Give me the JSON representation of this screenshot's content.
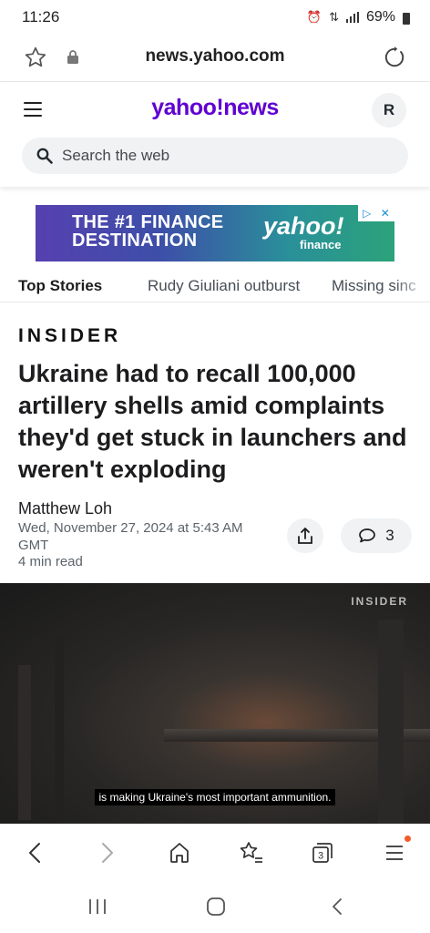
{
  "status": {
    "time": "11:26",
    "battery": "69%"
  },
  "browser": {
    "url": "news.yahoo.com",
    "tab_count": "3"
  },
  "header": {
    "logo_yahoo": "yahoo",
    "logo_bang": "!",
    "logo_news": "news",
    "avatar_initial": "R"
  },
  "search": {
    "placeholder": "Search the web"
  },
  "ad": {
    "headline": "THE #1 FINANCE DESTINATION",
    "logo": "yahoo!",
    "logo_sub": "finance"
  },
  "tabs": [
    {
      "label": "Top Stories"
    },
    {
      "label": "Rudy Giuliani outburst"
    },
    {
      "label": "Missing sinc"
    }
  ],
  "article": {
    "source": "INSIDER",
    "headline": "Ukraine had to recall 100,000 artillery shells amid complaints they'd get stuck in launchers and weren't exploding",
    "author": "Matthew Loh",
    "date": "Wed, November 27, 2024 at 5:43 AM GMT",
    "read_time": "4 min read",
    "comment_count": "3"
  },
  "video": {
    "brand": "INSIDER",
    "caption": "is making Ukraine's most important ammunition."
  },
  "icons": {
    "bookmark": "star-icon",
    "lock": "lock-icon",
    "reload": "reload-icon",
    "menu": "hamburger-icon",
    "search": "search-icon",
    "share": "share-icon",
    "comment": "comment-icon",
    "back": "back-icon",
    "forward": "forward-icon",
    "home": "home-icon",
    "bookmarks": "bookmarks-icon",
    "tabs": "tabs-icon",
    "more": "menu-icon"
  },
  "colors": {
    "yahoo_purple": "#6001d2",
    "notification_dot": "#f35b2a"
  }
}
